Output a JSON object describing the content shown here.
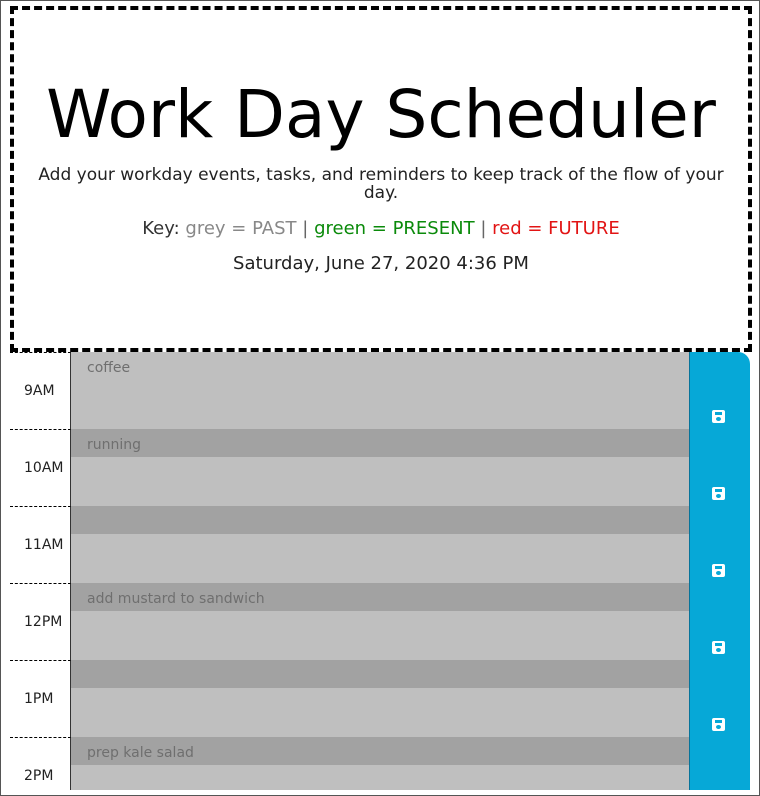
{
  "header": {
    "title": "Work Day Scheduler",
    "lead": "Add your workday events, tasks, and reminders to keep track of the flow of your day.",
    "key": {
      "prefix": "Key:",
      "past": "grey = PAST",
      "present": "green = PRESENT",
      "future": "red = FUTURE",
      "separator": "|"
    },
    "current_date": "Saturday, June 27, 2020 4:36 PM"
  },
  "colors": {
    "past": "#bfbfbf",
    "present": "#0a8a0a",
    "future": "#e21414",
    "save_button": "#06a8d7"
  },
  "save_icon": "floppy-disk-icon",
  "time_blocks": [
    {
      "hour": "9AM",
      "text": "coffee"
    },
    {
      "hour": "10AM",
      "text": "running"
    },
    {
      "hour": "11AM",
      "text": ""
    },
    {
      "hour": "12PM",
      "text": "add mustard to sandwich"
    },
    {
      "hour": "1PM",
      "text": ""
    },
    {
      "hour": "2PM",
      "text": "prep kale salad"
    }
  ]
}
